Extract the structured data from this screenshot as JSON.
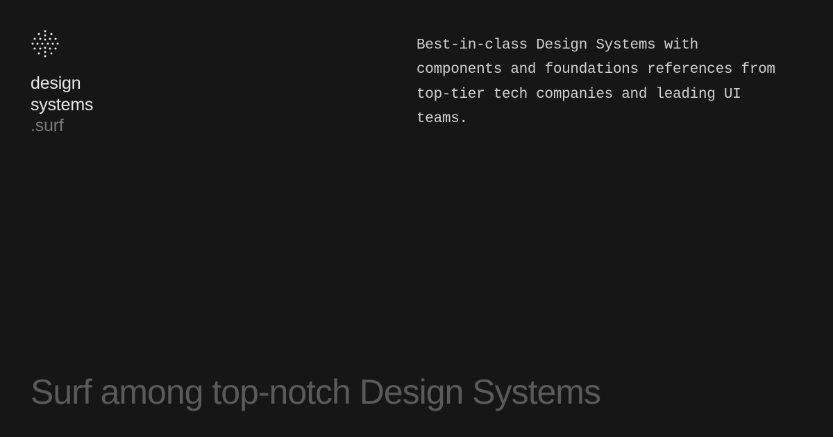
{
  "logo": {
    "line1": "design",
    "line2": "systems",
    "line3": ".surf"
  },
  "description": "Best-in-class Design Systems with components and foundations references from top-tier tech companies and leading UI teams.",
  "headline": "Surf among top-notch Design Systems"
}
